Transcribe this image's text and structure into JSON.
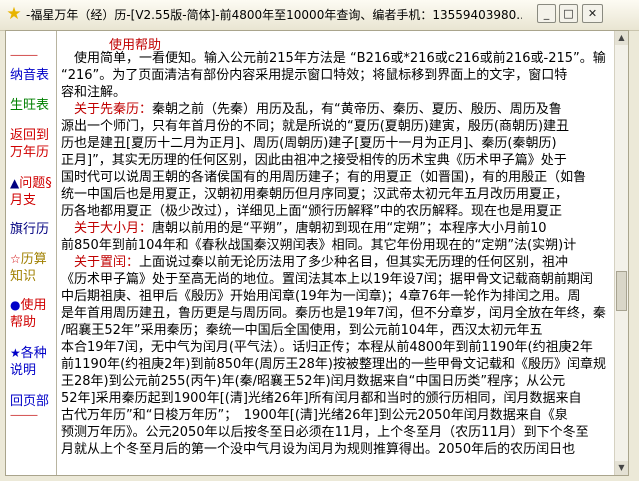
{
  "window": {
    "title": "-福星万年（经）历-[V2.55版-简体]-前4800年至10000年查询、编者手机：13559403980...",
    "icon": "star-icon",
    "minimize_glyph": "_",
    "maximize_glyph": "□",
    "close_glyph": "✕"
  },
  "sidebar": {
    "separator": "———",
    "items": [
      {
        "label": "纳音表",
        "glyph": ""
      },
      {
        "label": "生旺表",
        "glyph": ""
      },
      {
        "label": "返回到万年历",
        "glyph": ""
      },
      {
        "label": "问题§月支",
        "glyph": "▲"
      },
      {
        "label": "旗行历",
        "glyph": ""
      },
      {
        "label": "历算知识",
        "glyph": "☆"
      },
      {
        "label": "使用帮助",
        "glyph": "●"
      },
      {
        "label": "各种说明",
        "glyph": "★"
      },
      {
        "label": "回页部",
        "glyph": ""
      }
    ]
  },
  "help": {
    "title": "使用帮助",
    "lines": [
      {
        "head": "",
        "text": "　使用简单，一看便知。输入公元前215年方法是 “B216或*216或c216或前216或-215”。输"
      },
      {
        "head": "",
        "text": "“216”。为了页面清洁有部份内容采用提示窗口特效；将鼠标移到界面上的文字，窗口特"
      },
      {
        "head": "",
        "text": "容和注解。"
      },
      {
        "head": "　关于先秦历：",
        "text": "秦朝之前（先秦）用历及乱，有“黄帝历、秦历、夏历、殷历、周历及鲁"
      },
      {
        "head": "",
        "text": "源出一个师门，只有年首月份的不同；就是所说的“夏历(夏朝历)建寅，殷历(商朝历)建丑"
      },
      {
        "head": "",
        "text": "历也是建丑[夏历十二月为正月]、周历(周朝历)建子[夏历十一月为正月]、秦历(秦朝历)"
      },
      {
        "head": "",
        "text": "正月]”，其实无历理的任何区别，因此由祖冲之接受相传的历术宝典《历术甲子篇》处于"
      },
      {
        "head": "",
        "text": "国时代可以说周王朝的各诸侯国有的用周历建子；有的用夏正（如晋国)，有的用殷正（如鲁"
      },
      {
        "head": "",
        "text": "统一中国后也是用夏正，汉朝初用秦朝历但月序同夏；汉武帝太初元年五月改历用夏正，"
      },
      {
        "head": "",
        "text": "历各地都用夏正（极少改过），详细见上面“颁行历解释”中的农历解释。现在也是用夏正"
      },
      {
        "head": "　关于大小月：",
        "text": "唐朝以前用的是“平朔”，唐朝初到现在用“定朔”；本程序大小月前10"
      },
      {
        "head": "",
        "text": "前850年到前104年和《春秋战国秦汉朔闰表》相同。其它年份用现在的“定朔”法(实朔)计"
      },
      {
        "head": "　关于置闰：",
        "text": "上面说过秦以前无论历法用了多少种名目，但其实无历理的任何区别，祖冲"
      },
      {
        "head": "",
        "text": "《历术甲子篇》处于至高无尚的地位。置闰法其本上以19年设7闰；据甲骨文记载商朝前期闰"
      },
      {
        "head": "",
        "text": "中后期祖庚、祖甲后《殷历》开始用闰章(19年为一闰章)；4章76年一轮作为排闰之用。周"
      },
      {
        "head": "",
        "text": "是年首用周历建丑，鲁历更是与周历同。秦历也是19年7闰，但不分章岁，闰月全放在年终，秦"
      },
      {
        "head": "",
        "text": "/昭襄王52年”采用秦历；秦统一中国后全国使用，到公元前104年，西汉太初元年五"
      },
      {
        "head": "",
        "text": "本合19年7闰，无中气为闰月(平气法）。话归正传；本程从前4800年到前1190年(约祖庚2年"
      },
      {
        "head": "",
        "text": "前1190年(约祖庚2年)到前850年(周厉王28年)按被整理出的一些甲骨文记载和《殷历》闰章规"
      },
      {
        "head": "",
        "text": "王28年)到公元前255(丙午)年(秦/昭襄王52年)闰月数据来自“中国日历类”程序；从公元"
      },
      {
        "head": "",
        "text": "52年]采用秦历起到1900年[(清]光绪26年]所有闰月都和当时的颁行历相同，闰月数据来自"
      },
      {
        "head": "",
        "text": "古代万年历”和“日梭万年历”；　1900年[(清]光绪26年]到公元2050年闰月数据来自《泉"
      },
      {
        "head": "",
        "text": "预测万年历》。公元2050年以后按冬至日必须在11月，上个冬至月（农历11月）到下个冬至"
      },
      {
        "head": "",
        "text": "月就从上个冬至月后的第一个没中气月设为闰月为规则推算得出。2050年后的农历闰日也"
      }
    ]
  }
}
